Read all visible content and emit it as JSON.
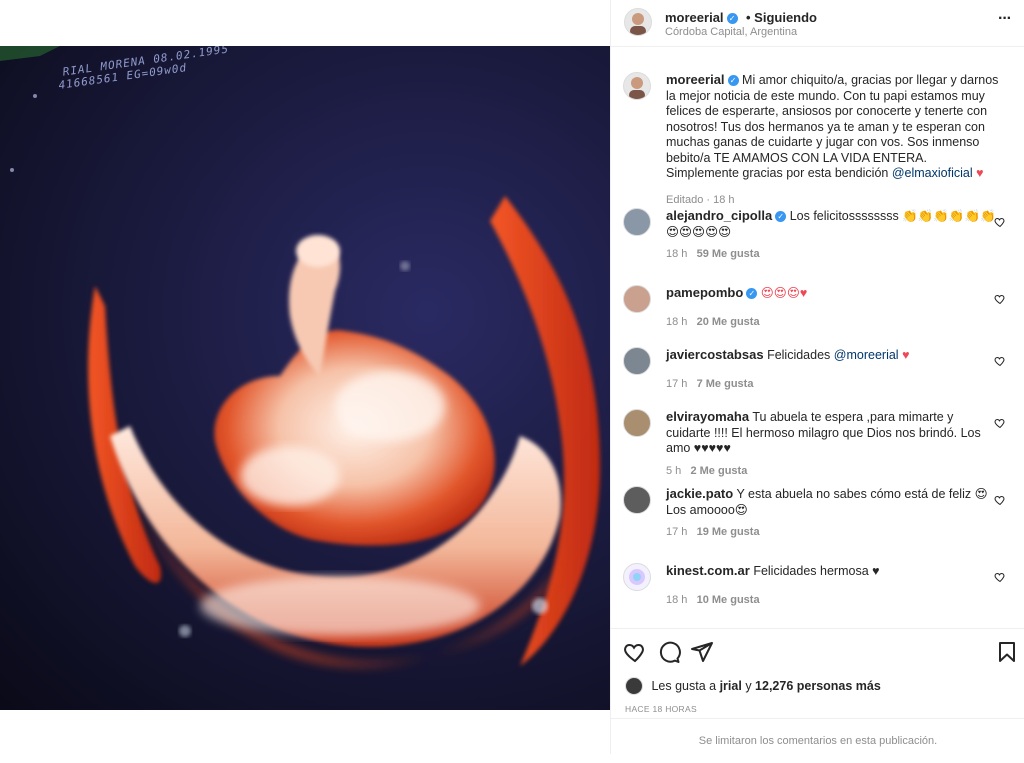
{
  "post": {
    "username": "moreerial",
    "follow_status": "• Siguiendo",
    "location": "Córdoba Capital, Argentina",
    "more_label": "···",
    "media_overlay": {
      "line1": "RIAL MORENA 08.02.1995",
      "line2": "41668561 EG=09w0d"
    }
  },
  "caption": {
    "username": "moreerial",
    "text": "Mi amor chiquito/a, gracias por llegar y darnos la mejor noticia de este mundo. Con tu papi estamos muy felices de esperarte, ansiosos por conocerte y tenerte con nosotros! Tus dos hermanos ya te aman y te esperan con muchas ganas de cuidarte y jugar con vos. Sos inmenso bebito/a TE AMAMOS CON LA VIDA ENTERA. Simplemente gracias por esta bendición",
    "mention": "@elmaxioficial",
    "emoji": "♥",
    "meta": "Editado · 18 h"
  },
  "comments": [
    {
      "username": "alejandro_cipolla",
      "verified": true,
      "text": "Los felicitossssssss 👏👏👏👏👏👏😍😍😍😍😍",
      "time": "18 h",
      "likes": "59 Me gusta"
    },
    {
      "username": "pamepombo",
      "verified": true,
      "text": "😍😍😍♥",
      "time": "18 h",
      "likes": "20 Me gusta"
    },
    {
      "username": "javiercostabsas",
      "verified": false,
      "text": "Felicidades",
      "mention": "@moreerial",
      "emoji": "♥",
      "time": "17 h",
      "likes": "7 Me gusta"
    },
    {
      "username": "elvirayomaha",
      "verified": false,
      "text": "Tu abuela te espera ,para mimarte y cuidarte !!!! El hermoso milagro que Dios nos brindó. Los amo ♥♥♥♥♥",
      "time": "5 h",
      "likes": "2 Me gusta"
    },
    {
      "username": "jackie.pato",
      "verified": false,
      "text": "Y esta abuela no sabes cómo está de feliz 😍 Los amoooo😍",
      "time": "17 h",
      "likes": "19 Me gusta"
    },
    {
      "username": "kinest.com.ar",
      "verified": false,
      "text": "Felicidades hermosa ♥",
      "time": "18 h",
      "likes": "10 Me gusta"
    }
  ],
  "likes_line": {
    "prefix": "Les gusta a",
    "user": "jrial",
    "middle": "y",
    "count": "12,276 personas más"
  },
  "timestamp": "HACE 18 HORAS",
  "footer": "Se limitaron los comentarios en esta publicación.",
  "colors": {
    "verified": "#3897f0",
    "heart": "#ed4956",
    "mention": "#00376b",
    "border": "#efefef"
  }
}
